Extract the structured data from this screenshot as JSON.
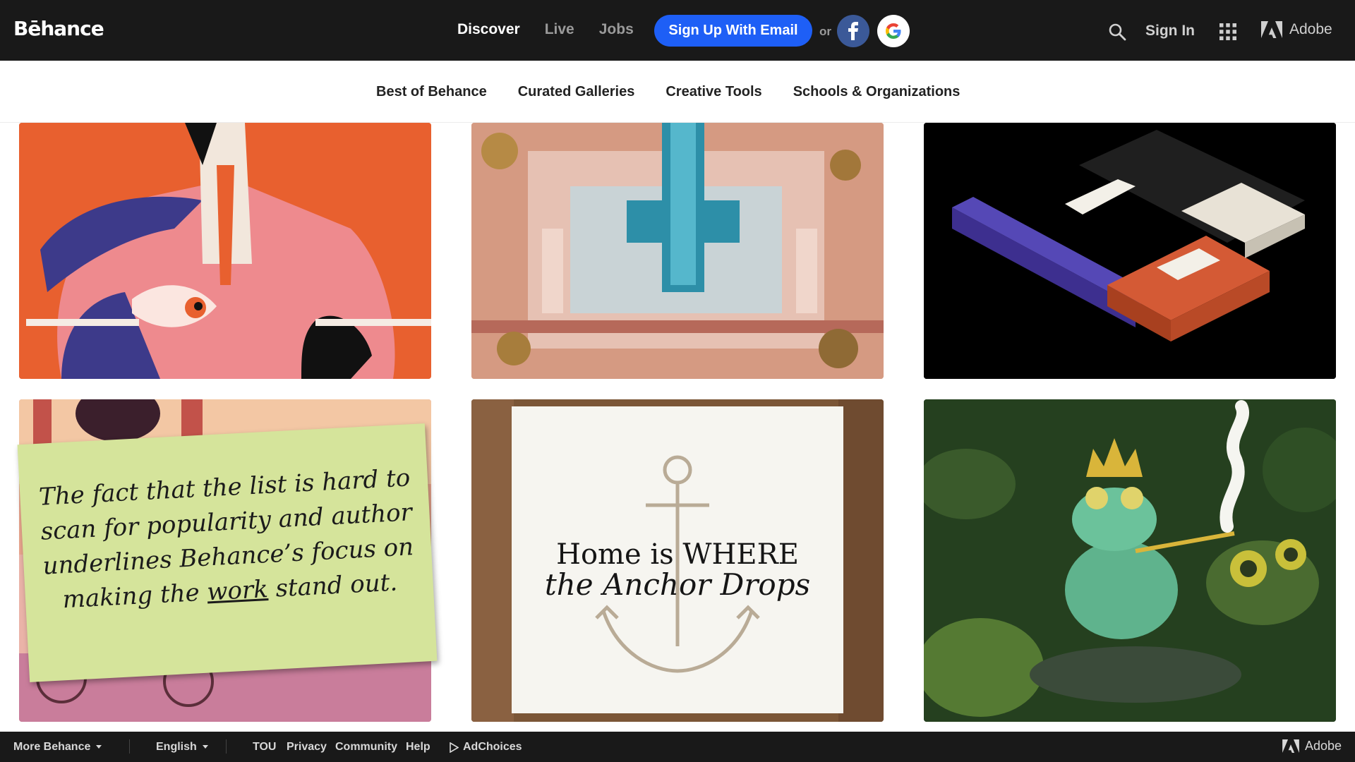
{
  "header": {
    "logo": "Bēhance",
    "nav": [
      {
        "label": "Discover",
        "active": true
      },
      {
        "label": "Live",
        "active": false
      },
      {
        "label": "Jobs",
        "active": false
      }
    ],
    "signup_label": "Sign Up With Email",
    "or_label": "or",
    "facebook_icon": "facebook-icon",
    "google_icon": "google-icon",
    "search_icon": "search-icon",
    "signin_label": "Sign In",
    "apps_icon": "apps-grid-icon",
    "adobe_label": "Adobe",
    "accent_color": "#1e5ff6"
  },
  "subnav": {
    "items": [
      "Best of Behance",
      "Curated Galleries",
      "Creative Tools",
      "Schools & Organizations"
    ]
  },
  "gallery": {
    "note": {
      "before": "The fact that the list is hard to scan for popularity and author underlines Behance’s focus on making the ",
      "underlined": "work",
      "after": " stand out."
    },
    "anchor_card": {
      "line1": "Home is WHERE",
      "line2": "the Anchor Drops"
    }
  },
  "footer": {
    "more": "More Behance",
    "language": "English",
    "links": [
      "TOU",
      "Privacy",
      "Community",
      "Help"
    ],
    "adchoices": "AdChoices",
    "adobe_label": "Adobe"
  }
}
